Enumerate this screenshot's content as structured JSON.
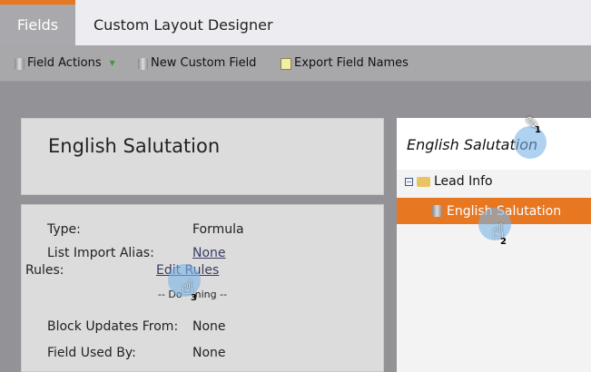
{
  "tabs": [
    {
      "label": "Fields",
      "active": true
    },
    {
      "label": "Custom Layout Designer",
      "active": false
    }
  ],
  "toolbar": {
    "field_actions": "Field Actions",
    "new_custom_field": "New Custom Field",
    "export_field_names": "Export Field Names"
  },
  "field": {
    "title": "English Salutation",
    "type_label": "Type:",
    "type_value": "Formula",
    "alias_label": "List Import Alias:",
    "alias_value": "None",
    "rules_label": "Rules:",
    "rules_link": "Edit Rules",
    "rules_status": "-- Do    ning --",
    "block_label": "Block Updates From:",
    "block_value": "None",
    "used_label": "Field Used By:",
    "used_value": "None"
  },
  "tree": {
    "header": "English Salutation",
    "folder": "Lead Info",
    "selected": "English Salutation"
  },
  "callouts": [
    "1",
    "2",
    "3"
  ],
  "colors": {
    "accent": "#e87722",
    "background": "#939397"
  }
}
